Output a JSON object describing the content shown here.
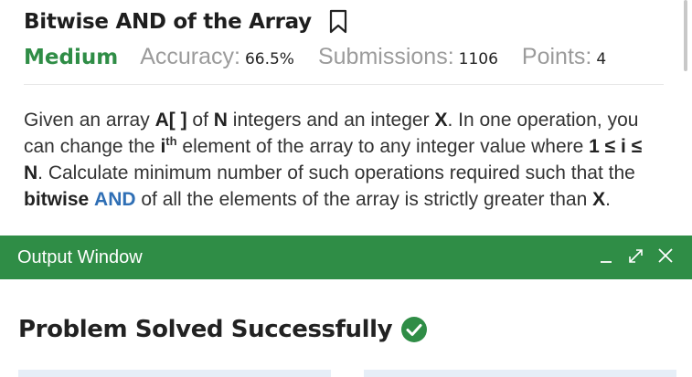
{
  "problem": {
    "title": "Bitwise AND of the Array",
    "difficulty": "Medium",
    "accuracy_label": "Accuracy:",
    "accuracy_value": "66.5%",
    "submissions_label": "Submissions:",
    "submissions_value": "1106",
    "points_label": "Points:",
    "points_value": "4",
    "statement": {
      "p1": "Given an array ",
      "arr": "A[ ]",
      "p2": " of ",
      "n": "N",
      "p3": " integers and an integer ",
      "x": "X",
      "p4": ". In one operation, you can change the ",
      "i": "i",
      "th": "th",
      "p5": " element of the array to any integer value where ",
      "cond": "1 ≤ i ≤ N",
      "p6": ". Calculate minimum number of such operations required such that the ",
      "bitwise": "bitwise",
      "and": "AND",
      "p7": " of all the elements of the array is strictly greater than ",
      "x2": "X",
      "p8": "."
    }
  },
  "output": {
    "title": "Output Window",
    "result": "Problem Solved Successfully"
  },
  "icons": {
    "bookmark": "bookmark-icon",
    "minimize": "minimize-icon",
    "expand": "expand-icon",
    "close": "close-icon",
    "success": "check-circle-icon"
  },
  "colors": {
    "brand_green": "#2f8d46",
    "link_blue": "#2f6fb5",
    "muted_gray": "#9b9b9b"
  }
}
